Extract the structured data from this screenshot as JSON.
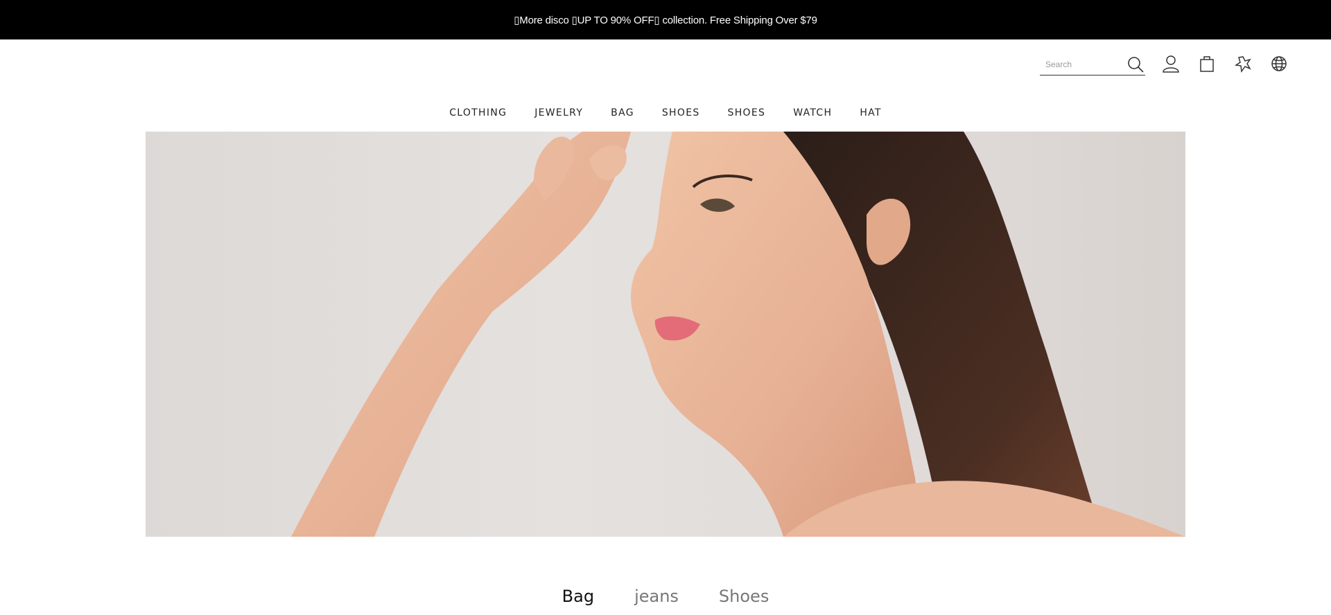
{
  "announcement": {
    "text": "▯More disco ▯UP TO 90% OFF▯ collection.  Free Shipping Over $79"
  },
  "search": {
    "placeholder": "Search",
    "value": ""
  },
  "header_icons": [
    "search-icon",
    "account-icon",
    "shopping-bag-icon",
    "wishlist-icon",
    "globe-icon"
  ],
  "nav": {
    "items": [
      {
        "label": "CLOTHING"
      },
      {
        "label": "JEWELRY"
      },
      {
        "label": "BAG"
      },
      {
        "label": "SHOES"
      },
      {
        "label": "SHOES"
      },
      {
        "label": "WATCH"
      },
      {
        "label": "HAT"
      }
    ]
  },
  "category_tabs": {
    "items": [
      {
        "label": "Bag",
        "active": true
      },
      {
        "label": "jeans",
        "active": false
      },
      {
        "label": "Shoes",
        "active": false
      }
    ]
  },
  "colors": {
    "announce_bg": "#000000",
    "announce_text": "#ffffff",
    "page_bg": "#ffffff",
    "hero_bg": "#e0dcda"
  }
}
